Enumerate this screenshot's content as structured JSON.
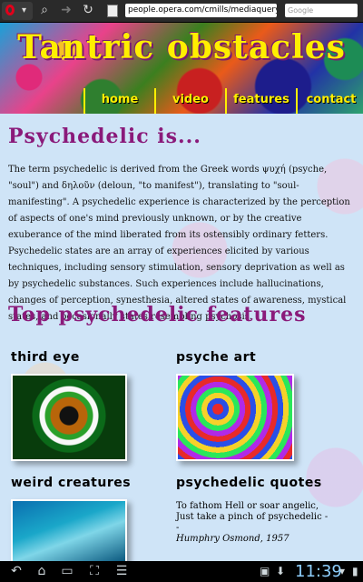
{
  "browser": {
    "url": "people.opera.com/cmills/mediaquery/",
    "search_placeholder": "Google"
  },
  "header": {
    "title": "Tantric obstacles",
    "menu": [
      "home",
      "video",
      "features",
      "contact"
    ]
  },
  "intro": {
    "heading": "Psychedelic is...",
    "paragraph": "The term psychedelic is derived from the Greek words ψυχή (psyche, \"soul\") and δηλοῦν (deloun, \"to manifest\"), translating to \"soul-manifesting\". A psychedelic experience is characterized by the perception of aspects of one's mind previously unknown, or by the creative exuberance of the mind liberated from its ostensibly ordinary fetters. Psychedelic states are an array of experiences elicited by various techniques, including sensory stimulation, sensory deprivation as well as by psychedelic substances. Such experiences include hallucinations, changes of perception, synesthesia, altered states of awareness, mystical states, and occasionally states resembling psychosis."
  },
  "features": {
    "heading": "Top psychedelic features",
    "items": [
      {
        "title": "third eye"
      },
      {
        "title": "psyche art"
      },
      {
        "title": "weird creatures"
      },
      {
        "title": "psychedelic quotes"
      }
    ],
    "quote": {
      "text": "To fathom Hell or soar angelic, Just take a pinch of psychedelic --",
      "author": "Humphry Osmond, 1957"
    }
  },
  "sysbar": {
    "time": "11:39"
  },
  "colors": {
    "title": "#ffef00",
    "heading": "#8a1a7a",
    "background": "#cfe4f7"
  }
}
